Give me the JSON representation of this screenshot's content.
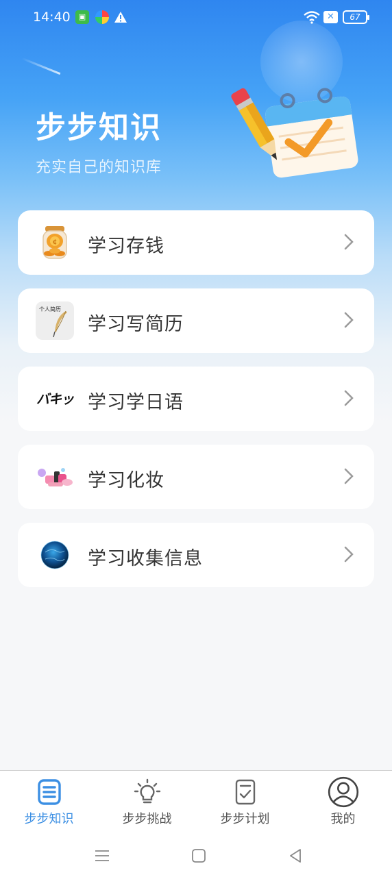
{
  "status_bar": {
    "time": "14:40",
    "battery": "67",
    "icons": [
      "app-icon",
      "colorful-app-icon",
      "warning-icon",
      "wifi-icon",
      "sim-x-icon",
      "battery-icon"
    ]
  },
  "header": {
    "title": "步步知识",
    "subtitle": "充实自己的知识库"
  },
  "cards": [
    {
      "label": "学习存钱",
      "icon": "money-jar-icon"
    },
    {
      "label": "学习写简历",
      "icon": "resume-icon",
      "icon_text": "个人简历"
    },
    {
      "label": "学习学日语",
      "icon": "japanese-icon",
      "icon_text": "バキッ"
    },
    {
      "label": "学习化妆",
      "icon": "cosmetics-icon"
    },
    {
      "label": "学习收集信息",
      "icon": "globe-icon"
    }
  ],
  "tabs": [
    {
      "label": "步步知识",
      "icon": "knowledge-icon",
      "active": true
    },
    {
      "label": "步步挑战",
      "icon": "lightbulb-icon",
      "active": false
    },
    {
      "label": "步步计划",
      "icon": "checklist-icon",
      "active": false
    },
    {
      "label": "我的",
      "icon": "profile-icon",
      "active": false
    }
  ],
  "colors": {
    "accent": "#3c8fe3",
    "header_blue": "#2f86f0",
    "background": "#f6f7f9"
  }
}
